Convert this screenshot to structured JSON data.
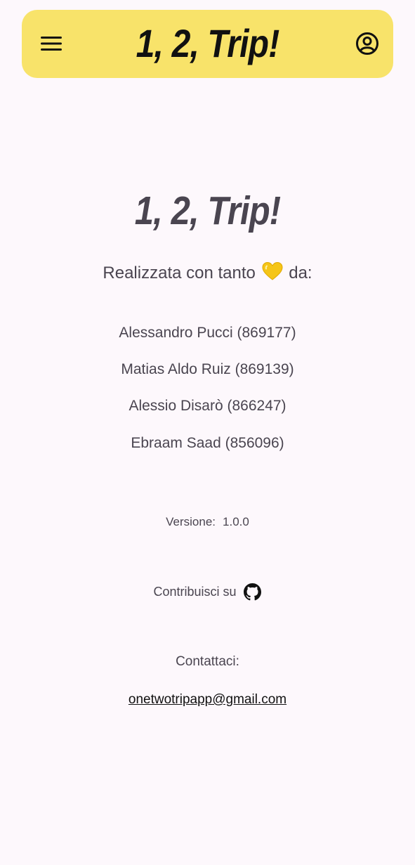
{
  "app_bar": {
    "title": "1, 2, Trip!",
    "menu_icon": "menu-icon",
    "account_icon": "account-circle-icon",
    "background_color": "#f8e36a"
  },
  "about": {
    "title": "1, 2, Trip!",
    "made_with_prefix": "Realizzata con tanto",
    "made_with_suffix": "da:",
    "heart_icon": "yellow-heart-icon",
    "authors": [
      "Alessandro Pucci (869177)",
      "Matias Aldo Ruiz (869139)",
      "Alessio Disarò (866247)",
      "Ebraam Saad (856096)"
    ],
    "version_label": "Versione:",
    "version_value": "1.0.0",
    "contribute_label": "Contribuisci su",
    "github_icon": "github-icon",
    "contact_label": "Contattaci:",
    "contact_email": "onetwotripapp@gmail.com"
  },
  "colors": {
    "background": "#fdf8fc",
    "accent": "#f8e36a",
    "text": "#4a4550"
  }
}
